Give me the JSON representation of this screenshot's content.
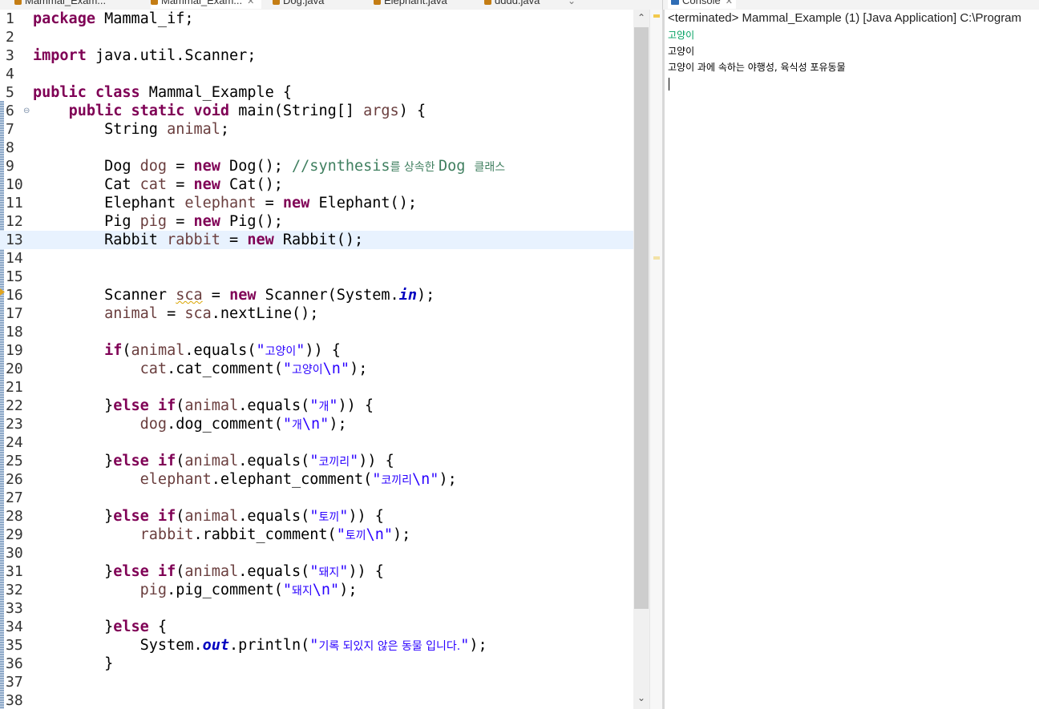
{
  "editor_tabs": [
    {
      "label": "Mammal_Exam...",
      "active": false
    },
    {
      "label": "Mammal_Exam...",
      "active": true
    },
    {
      "label": "Dog.java",
      "active": false
    },
    {
      "label": "Elephant.java",
      "active": false
    },
    {
      "label": "dddd.java",
      "active": false
    }
  ],
  "editor": {
    "current_line": 13,
    "lines": [
      {
        "n": "1",
        "tokens": [
          [
            "k",
            "package"
          ],
          [
            "p",
            " Mammal_if;"
          ]
        ]
      },
      {
        "n": "2",
        "tokens": []
      },
      {
        "n": "3",
        "tokens": [
          [
            "k",
            "import"
          ],
          [
            "p",
            " java.util.Scanner;"
          ]
        ]
      },
      {
        "n": "4",
        "tokens": []
      },
      {
        "n": "5",
        "tokens": [
          [
            "k",
            "public"
          ],
          [
            "p",
            " "
          ],
          [
            "k",
            "class"
          ],
          [
            "p",
            " Mammal_Example {"
          ]
        ]
      },
      {
        "n": "6",
        "tokens": [
          [
            "p",
            "    "
          ],
          [
            "k",
            "public"
          ],
          [
            "p",
            " "
          ],
          [
            "k",
            "static"
          ],
          [
            "p",
            " "
          ],
          [
            "k",
            "void"
          ],
          [
            "p",
            " main(String[] "
          ],
          [
            "v",
            "args"
          ],
          [
            "p",
            ") {"
          ]
        ]
      },
      {
        "n": "7",
        "tokens": [
          [
            "p",
            "        String "
          ],
          [
            "v",
            "animal"
          ],
          [
            "p",
            ";"
          ]
        ]
      },
      {
        "n": "8",
        "tokens": []
      },
      {
        "n": "9",
        "tokens": [
          [
            "p",
            "        Dog "
          ],
          [
            "v",
            "dog"
          ],
          [
            "p",
            " = "
          ],
          [
            "k",
            "new"
          ],
          [
            "p",
            " Dog(); "
          ],
          [
            "c",
            "//synthesis"
          ],
          [
            "cko",
            "를 상속한 "
          ],
          [
            "c",
            "Dog "
          ],
          [
            "cko",
            "클래스"
          ]
        ]
      },
      {
        "n": "10",
        "tokens": [
          [
            "p",
            "        Cat "
          ],
          [
            "v",
            "cat"
          ],
          [
            "p",
            " = "
          ],
          [
            "k",
            "new"
          ],
          [
            "p",
            " Cat();"
          ]
        ]
      },
      {
        "n": "11",
        "tokens": [
          [
            "p",
            "        Elephant "
          ],
          [
            "v",
            "elephant"
          ],
          [
            "p",
            " = "
          ],
          [
            "k",
            "new"
          ],
          [
            "p",
            " Elephant();"
          ]
        ]
      },
      {
        "n": "12",
        "tokens": [
          [
            "p",
            "        Pig "
          ],
          [
            "v",
            "pig"
          ],
          [
            "p",
            " = "
          ],
          [
            "k",
            "new"
          ],
          [
            "p",
            " Pig();"
          ]
        ]
      },
      {
        "n": "13",
        "tokens": [
          [
            "p",
            "        Rabbit "
          ],
          [
            "v",
            "rabbit"
          ],
          [
            "p",
            " = "
          ],
          [
            "k",
            "new"
          ],
          [
            "p",
            " Rabbit();"
          ]
        ]
      },
      {
        "n": "14",
        "tokens": []
      },
      {
        "n": "15",
        "tokens": []
      },
      {
        "n": "16",
        "tokens": [
          [
            "p",
            "        Scanner "
          ],
          [
            "vw",
            "sca"
          ],
          [
            "p",
            " = "
          ],
          [
            "k",
            "new"
          ],
          [
            "p",
            " Scanner(System."
          ],
          [
            "f",
            "in"
          ],
          [
            "p",
            ");"
          ]
        ]
      },
      {
        "n": "17",
        "tokens": [
          [
            "p",
            "        "
          ],
          [
            "v",
            "animal"
          ],
          [
            "p",
            " = "
          ],
          [
            "v",
            "sca"
          ],
          [
            "p",
            ".nextLine();"
          ]
        ]
      },
      {
        "n": "18",
        "tokens": []
      },
      {
        "n": "19",
        "tokens": [
          [
            "p",
            "        "
          ],
          [
            "k",
            "if"
          ],
          [
            "p",
            "("
          ],
          [
            "v",
            "animal"
          ],
          [
            "p",
            ".equals("
          ],
          [
            "s",
            "\""
          ],
          [
            "sko",
            "고양이"
          ],
          [
            "s",
            "\""
          ],
          [
            "p",
            ")) {"
          ]
        ]
      },
      {
        "n": "20",
        "tokens": [
          [
            "p",
            "            "
          ],
          [
            "v",
            "cat"
          ],
          [
            "p",
            ".cat_comment("
          ],
          [
            "s",
            "\""
          ],
          [
            "sko",
            "고양이"
          ],
          [
            "s",
            "\\n\""
          ],
          [
            "p",
            ");"
          ]
        ]
      },
      {
        "n": "21",
        "tokens": []
      },
      {
        "n": "22",
        "tokens": [
          [
            "p",
            "        }"
          ],
          [
            "k",
            "else"
          ],
          [
            "p",
            " "
          ],
          [
            "k",
            "if"
          ],
          [
            "p",
            "("
          ],
          [
            "v",
            "animal"
          ],
          [
            "p",
            ".equals("
          ],
          [
            "s",
            "\""
          ],
          [
            "sko",
            "개"
          ],
          [
            "s",
            "\""
          ],
          [
            "p",
            ")) {"
          ]
        ]
      },
      {
        "n": "23",
        "tokens": [
          [
            "p",
            "            "
          ],
          [
            "v",
            "dog"
          ],
          [
            "p",
            ".dog_comment("
          ],
          [
            "s",
            "\""
          ],
          [
            "sko",
            "개"
          ],
          [
            "s",
            "\\n\""
          ],
          [
            "p",
            ");"
          ]
        ]
      },
      {
        "n": "24",
        "tokens": []
      },
      {
        "n": "25",
        "tokens": [
          [
            "p",
            "        }"
          ],
          [
            "k",
            "else"
          ],
          [
            "p",
            " "
          ],
          [
            "k",
            "if"
          ],
          [
            "p",
            "("
          ],
          [
            "v",
            "animal"
          ],
          [
            "p",
            ".equals("
          ],
          [
            "s",
            "\""
          ],
          [
            "sko",
            "코끼리"
          ],
          [
            "s",
            "\""
          ],
          [
            "p",
            ")) {"
          ]
        ]
      },
      {
        "n": "26",
        "tokens": [
          [
            "p",
            "            "
          ],
          [
            "v",
            "elephant"
          ],
          [
            "p",
            ".elephant_comment("
          ],
          [
            "s",
            "\""
          ],
          [
            "sko",
            "코끼리"
          ],
          [
            "s",
            "\\n\""
          ],
          [
            "p",
            ");"
          ]
        ]
      },
      {
        "n": "27",
        "tokens": []
      },
      {
        "n": "28",
        "tokens": [
          [
            "p",
            "        }"
          ],
          [
            "k",
            "else"
          ],
          [
            "p",
            " "
          ],
          [
            "k",
            "if"
          ],
          [
            "p",
            "("
          ],
          [
            "v",
            "animal"
          ],
          [
            "p",
            ".equals("
          ],
          [
            "s",
            "\""
          ],
          [
            "sko",
            "토끼"
          ],
          [
            "s",
            "\""
          ],
          [
            "p",
            ")) {"
          ]
        ]
      },
      {
        "n": "29",
        "tokens": [
          [
            "p",
            "            "
          ],
          [
            "v",
            "rabbit"
          ],
          [
            "p",
            ".rabbit_comment("
          ],
          [
            "s",
            "\""
          ],
          [
            "sko",
            "토끼"
          ],
          [
            "s",
            "\\n\""
          ],
          [
            "p",
            ");"
          ]
        ]
      },
      {
        "n": "30",
        "tokens": []
      },
      {
        "n": "31",
        "tokens": [
          [
            "p",
            "        }"
          ],
          [
            "k",
            "else"
          ],
          [
            "p",
            " "
          ],
          [
            "k",
            "if"
          ],
          [
            "p",
            "("
          ],
          [
            "v",
            "animal"
          ],
          [
            "p",
            ".equals("
          ],
          [
            "s",
            "\""
          ],
          [
            "sko",
            "돼지"
          ],
          [
            "s",
            "\""
          ],
          [
            "p",
            ")) {"
          ]
        ]
      },
      {
        "n": "32",
        "tokens": [
          [
            "p",
            "            "
          ],
          [
            "v",
            "pig"
          ],
          [
            "p",
            ".pig_comment("
          ],
          [
            "s",
            "\""
          ],
          [
            "sko",
            "돼지"
          ],
          [
            "s",
            "\\n\""
          ],
          [
            "p",
            ");"
          ]
        ]
      },
      {
        "n": "33",
        "tokens": []
      },
      {
        "n": "34",
        "tokens": [
          [
            "p",
            "        }"
          ],
          [
            "k",
            "else"
          ],
          [
            "p",
            " {"
          ]
        ]
      },
      {
        "n": "35",
        "tokens": [
          [
            "p",
            "            System."
          ],
          [
            "f",
            "out"
          ],
          [
            "p",
            ".println("
          ],
          [
            "s",
            "\""
          ],
          [
            "sko",
            "기록 되있지 않은 동물 입니다."
          ],
          [
            "s",
            "\""
          ],
          [
            "p",
            ");"
          ]
        ]
      },
      {
        "n": "36",
        "tokens": [
          [
            "p",
            "        }"
          ]
        ]
      },
      {
        "n": "37",
        "tokens": []
      },
      {
        "n": "38",
        "tokens": []
      }
    ]
  },
  "console": {
    "tab_label": "Console",
    "header": "<terminated> Mammal_Example (1) [Java Application] C:\\Program",
    "lines": [
      {
        "text": "고양이",
        "color": "#00a060"
      },
      {
        "text": "고양이",
        "color": "#000000"
      },
      {
        "text": "고양이 과에 속하는 야행성, 육식성 포유동물",
        "color": "#000000"
      }
    ]
  },
  "colors": {
    "keyword": "#7f0055",
    "local_variable": "#6a3e3e",
    "comment": "#3f7f5f",
    "string": "#2a00ff",
    "static_field": "#0000c0",
    "current_line_highlight": "#e8f2fe",
    "console_input": "#00a060"
  },
  "icons": {
    "fold": "minus-circle-icon",
    "warning": "warning-marker-icon",
    "scroll_up": "chevron-up-icon",
    "scroll_down": "chevron-down-icon"
  }
}
